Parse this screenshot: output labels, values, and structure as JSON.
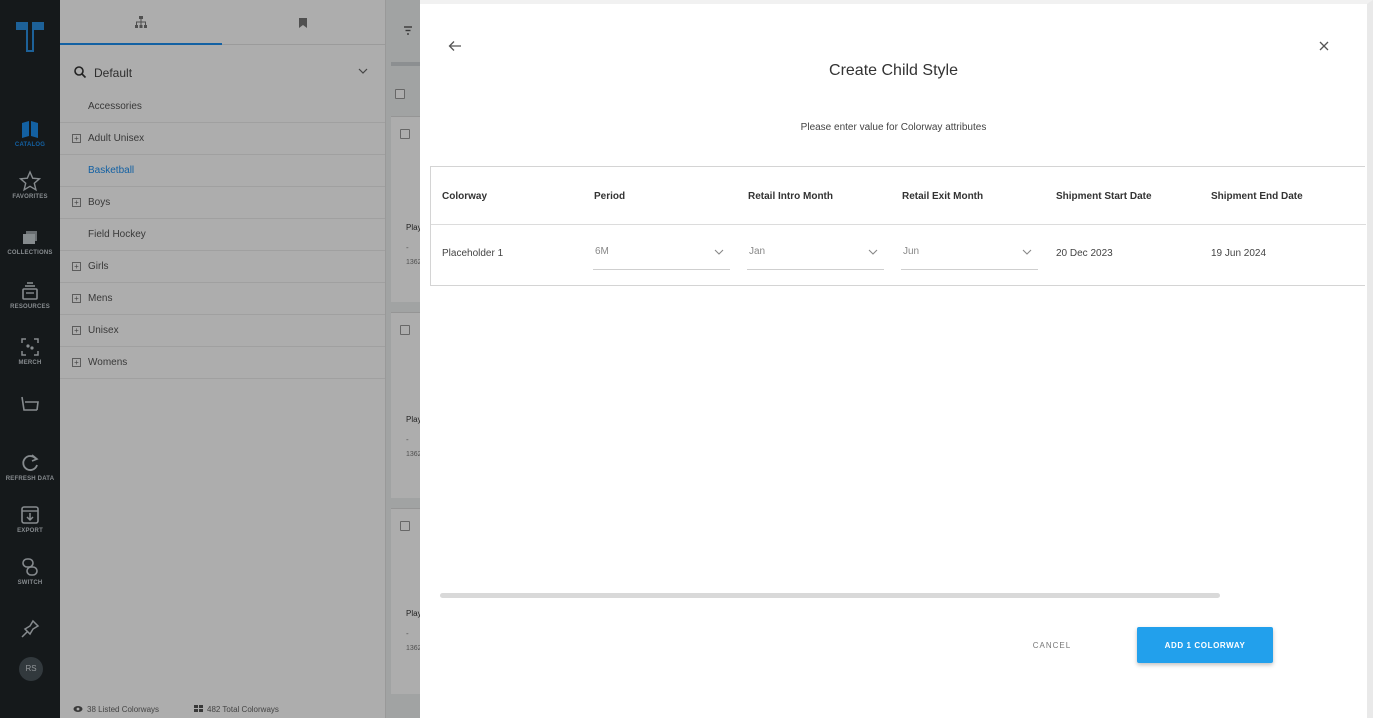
{
  "rail": {
    "items": [
      {
        "label": "CATALOG",
        "icon": "book-icon"
      },
      {
        "label": "FAVORITES",
        "icon": "star-icon"
      },
      {
        "label": "COLLECTIONS",
        "icon": "collections-icon"
      },
      {
        "label": "RESOURCES",
        "icon": "resources-icon"
      },
      {
        "label": "MERCH",
        "icon": "merch-icon"
      },
      {
        "label": "",
        "icon": "basket-icon"
      },
      {
        "label": "REFRESH DATA",
        "icon": "refresh-icon"
      },
      {
        "label": "EXPORT",
        "icon": "export-icon"
      },
      {
        "label": "SWITCH",
        "icon": "switch-icon"
      },
      {
        "label": "",
        "icon": "pin-icon"
      }
    ],
    "avatar": "RS"
  },
  "tree": {
    "search_value": "Default",
    "items": [
      {
        "label": "Accessories",
        "expandable": false,
        "selected": false
      },
      {
        "label": "Adult Unisex",
        "expandable": true,
        "selected": false
      },
      {
        "label": "Basketball",
        "expandable": false,
        "selected": true
      },
      {
        "label": "Boys",
        "expandable": true,
        "selected": false
      },
      {
        "label": "Field Hockey",
        "expandable": false,
        "selected": false
      },
      {
        "label": "Girls",
        "expandable": true,
        "selected": false
      },
      {
        "label": "Mens",
        "expandable": true,
        "selected": false
      },
      {
        "label": "Unisex",
        "expandable": true,
        "selected": false
      },
      {
        "label": "Womens",
        "expandable": true,
        "selected": false
      }
    ],
    "footer_listed": "38 Listed Colorways",
    "footer_total": "482 Total Colorways"
  },
  "list_peek": {
    "play": "Play",
    "dash": "-",
    "num": "1362"
  },
  "modal": {
    "title": "Create Child Style",
    "subtitle": "Please enter value for Colorway attributes",
    "columns": [
      "Colorway",
      "Period",
      "Retail Intro Month",
      "Retail Exit Month",
      "Shipment Start Date",
      "Shipment End Date"
    ],
    "row": {
      "colorway": "Placeholder 1",
      "period": "6M",
      "intro_month": "Jan",
      "exit_month": "Jun",
      "ship_start": "20 Dec 2023",
      "ship_end": "19 Jun 2024"
    },
    "cancel_label": "CANCEL",
    "add_label": "ADD 1 COLORWAY"
  },
  "colors": {
    "accent": "#1d8ff0",
    "add_button": "#22a0ec",
    "rail_bg": "#1f2529"
  }
}
